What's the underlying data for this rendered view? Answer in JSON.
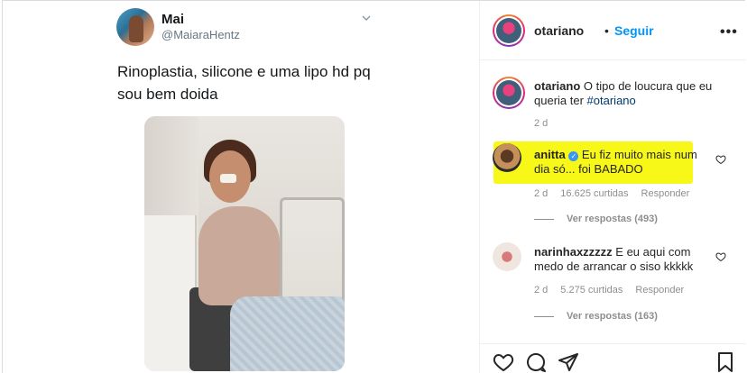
{
  "tweet": {
    "name": "Mai",
    "handle": "@MaiaraHentz",
    "text": "Rinoplastia, silicone e uma lipo hd pq sou bem doida",
    "photo_description_icon": "hospital-photo"
  },
  "header": {
    "username": "otariano",
    "dot": "•",
    "follow_label": "Seguir",
    "more_icon": "more-horizontal-icon"
  },
  "caption": {
    "username": "otariano",
    "text": " O tipo de loucura que eu queria ter ",
    "hashtag": "#otariano",
    "time": "2 d"
  },
  "comments": [
    {
      "username": "anitta",
      "verified": true,
      "text": " Eu fiz muito mais num dia só... foi BABADO",
      "time": "2 d",
      "likes": "16.625 curtidas",
      "reply_label": "Responder",
      "view_replies": "Ver respostas (493)",
      "highlight_color": "#f7f718"
    },
    {
      "username": "narinhaxzzzzz",
      "verified": false,
      "text": " E eu aqui com medo de arrancar o siso kkkkk",
      "time": "2 d",
      "likes": "5.275 curtidas",
      "reply_label": "Responder",
      "view_replies": "Ver respostas (163)"
    }
  ],
  "colors": {
    "accent": "#0095f6",
    "muted": "#8e8e8e",
    "text": "#262626"
  }
}
